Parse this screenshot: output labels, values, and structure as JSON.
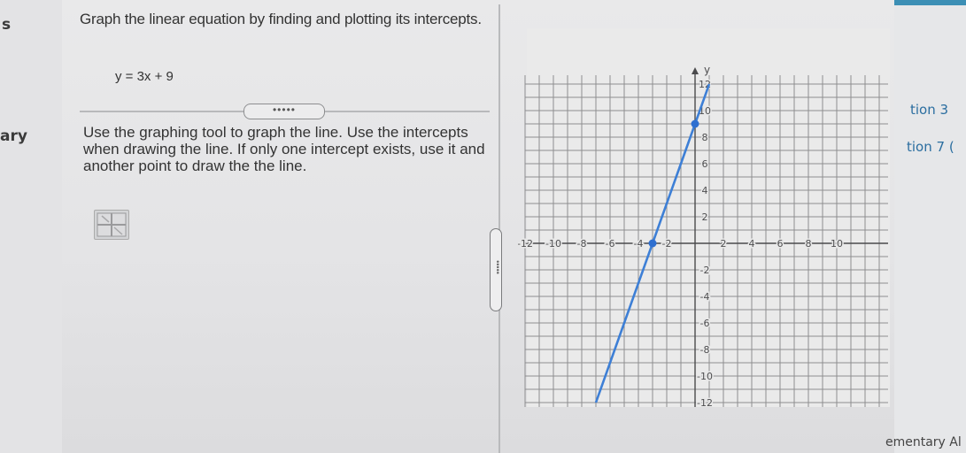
{
  "left_fragments": [
    "s",
    "ary"
  ],
  "question": {
    "prompt": "Graph the linear equation by finding and plotting its intercepts.",
    "equation": "y = 3x + 9",
    "expander": "•••••",
    "instructions": "Use the graphing tool to graph the line. Use the intercepts when drawing the line. If only one intercept exists, use it and another point to draw the the line."
  },
  "resize_handle_label": "•••••",
  "right_fragments": [
    "tion 3",
    "tion 7 (",
    "ementary Al"
  ],
  "chart_data": {
    "type": "line",
    "xlim": [
      -12,
      12
    ],
    "ylim": [
      -12,
      12
    ],
    "grid": true,
    "axis_name_y": "y",
    "x_tick_labels": [
      "-12",
      "-10",
      "-8",
      "-6",
      "-4",
      "-2",
      "2",
      "4",
      "6",
      "8",
      "10"
    ],
    "x_tick_values": [
      -12,
      -10,
      -8,
      -6,
      -4,
      -2,
      2,
      4,
      6,
      8,
      10
    ],
    "y_tick_labels": [
      "12",
      "10",
      "8",
      "6",
      "4",
      "2",
      "-2",
      "-4",
      "-6",
      "-8",
      "-10",
      "-12"
    ],
    "y_tick_values": [
      12,
      10,
      8,
      6,
      4,
      2,
      -2,
      -4,
      -6,
      -8,
      -10,
      -12
    ],
    "series": [
      {
        "values": [
          [
            -7,
            -12
          ],
          [
            1,
            12
          ]
        ],
        "color": "#3d7fd6"
      }
    ],
    "points": [
      [
        -3,
        0
      ],
      [
        0,
        9
      ]
    ],
    "point_color": "#2e6fd0"
  }
}
